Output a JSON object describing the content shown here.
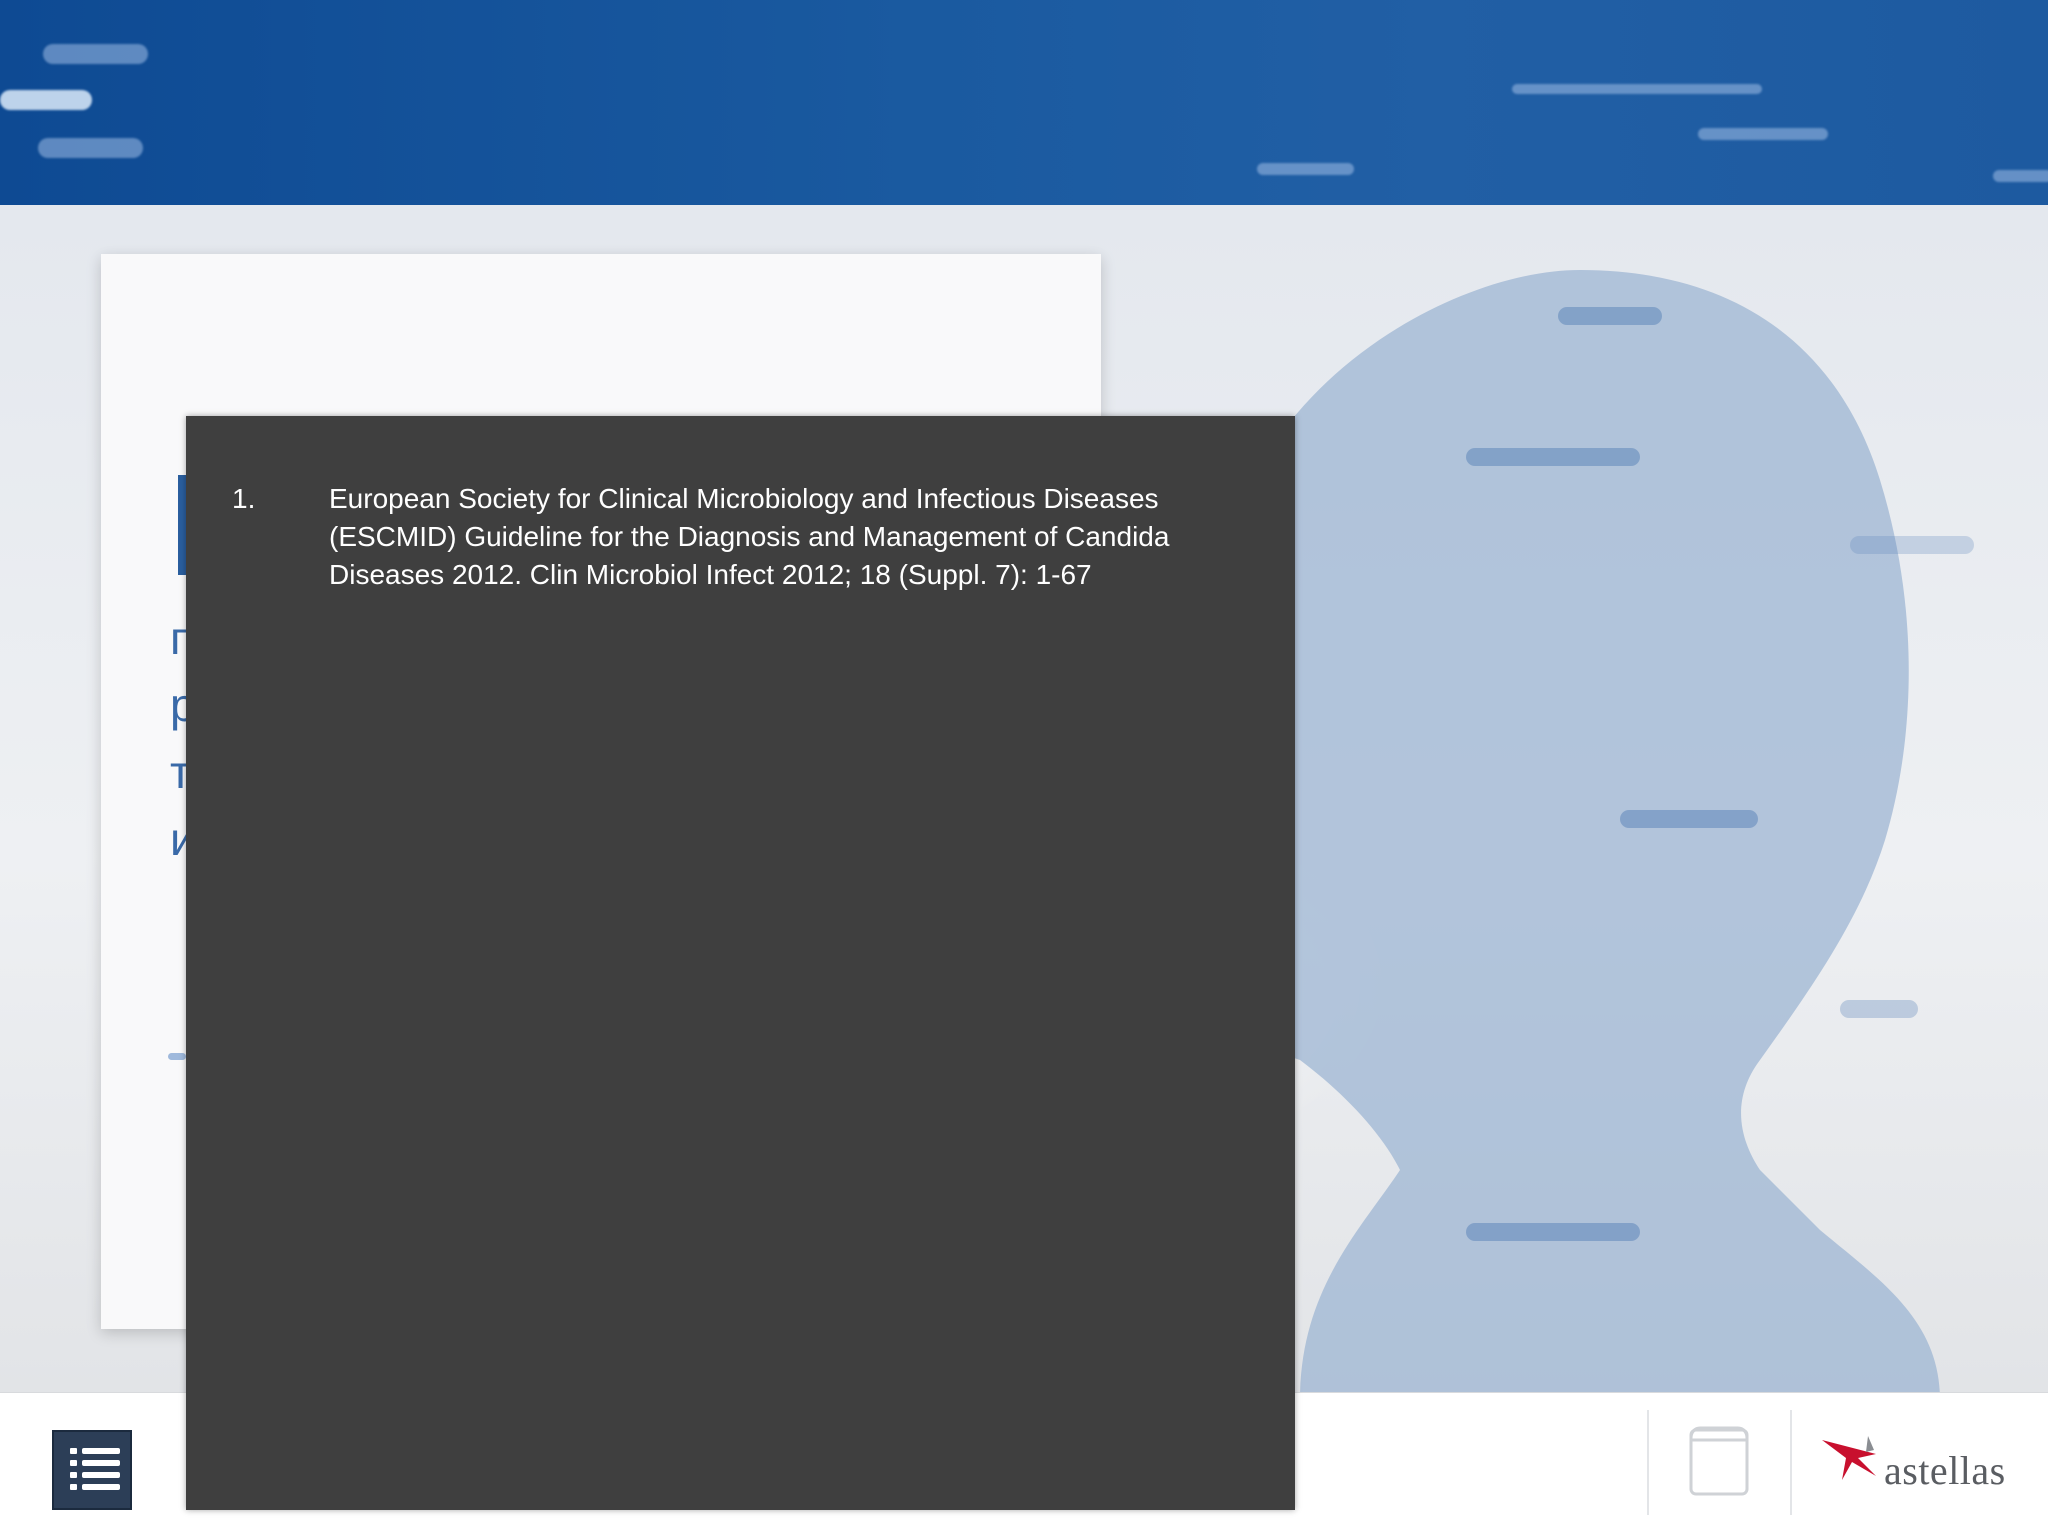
{
  "references": {
    "items": [
      {
        "number": "1.",
        "text": "European Society for Clinical Microbiology and Infectious Diseases (ESCMID) Guideline for the Diagnosis and Management of Candida Diseases 2012. Clin Microbiol Infect 2012; 18 (Suppl. 7): 1-67"
      }
    ]
  },
  "card": {
    "lines": [
      "п",
      "р",
      "т",
      "и"
    ]
  },
  "footer": {
    "menu_icon": "list-menu-icon",
    "reference_icon": "book-icon",
    "logo_text": "astellas"
  },
  "colors": {
    "header": "#1a5aa0",
    "popup": "#3f3f3f",
    "menu_button": "#2c3e57",
    "logo_red": "#c8102e"
  }
}
